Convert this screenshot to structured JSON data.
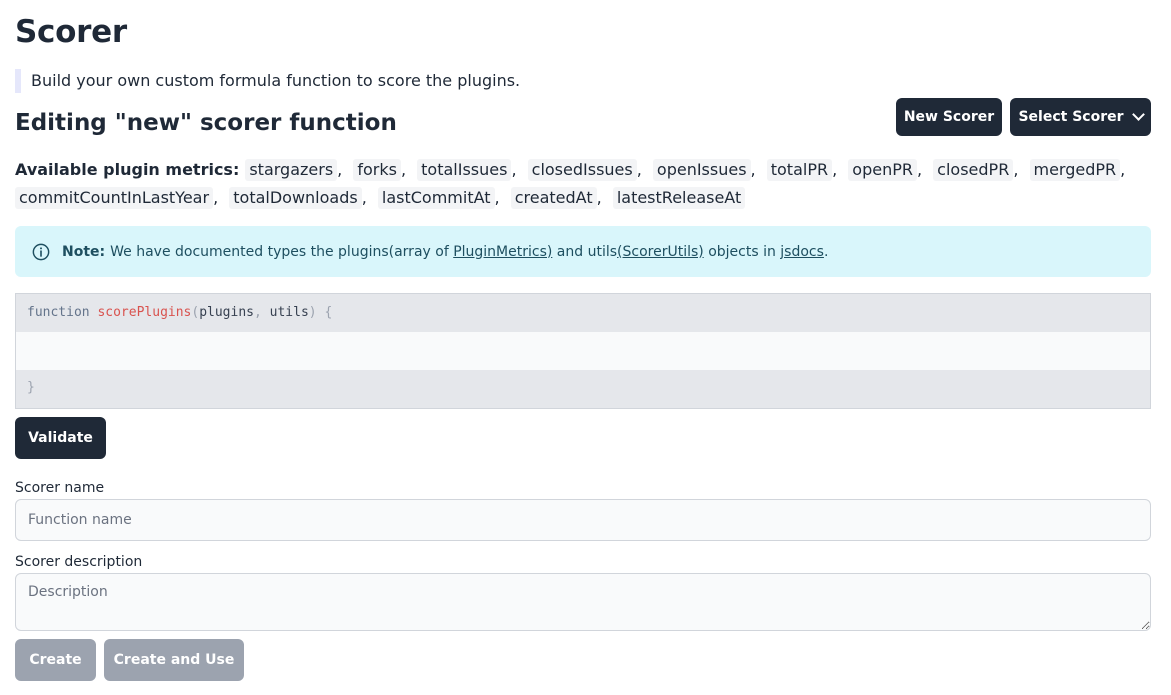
{
  "header": {
    "title": "Scorer",
    "subtitle": "Build your own custom formula function to score the plugins."
  },
  "editing": {
    "heading": "Editing \"new\" scorer function",
    "new_button": "New Scorer",
    "select_button": "Select Scorer"
  },
  "metrics": {
    "label": "Available plugin metrics:",
    "items": [
      "stargazers",
      "forks",
      "totalIssues",
      "closedIssues",
      "openIssues",
      "totalPR",
      "openPR",
      "closedPR",
      "mergedPR",
      "commitCountInLastYear",
      "totalDownloads",
      "lastCommitAt",
      "createdAt",
      "latestReleaseAt"
    ],
    "separator": ","
  },
  "note": {
    "label": "Note:",
    "text1": "We have documented types the plugins(array of",
    "link1": "PluginMetrics)",
    "text2": "and utils",
    "link2": "(ScorerUtils)",
    "text3": "objects in",
    "link3": "jsdocs",
    "text4": "."
  },
  "editor": {
    "keyword": "function",
    "fn_name": "scorePlugins",
    "open_paren": "(",
    "param1": "plugins",
    "comma": ",",
    "param2": "utils",
    "close_paren": ")",
    "open_brace": "{",
    "close_brace": "}"
  },
  "actions": {
    "validate_label": "Validate",
    "create_label": "Create",
    "create_use_label": "Create and Use"
  },
  "form": {
    "name_label": "Scorer name",
    "name_placeholder": "Function name",
    "desc_label": "Scorer description",
    "desc_placeholder": "Description"
  },
  "colors": {
    "primary": "#1f2937",
    "disabled": "#9ca3af",
    "note_bg": "#d9f6fb",
    "note_text": "#1e4f60"
  }
}
